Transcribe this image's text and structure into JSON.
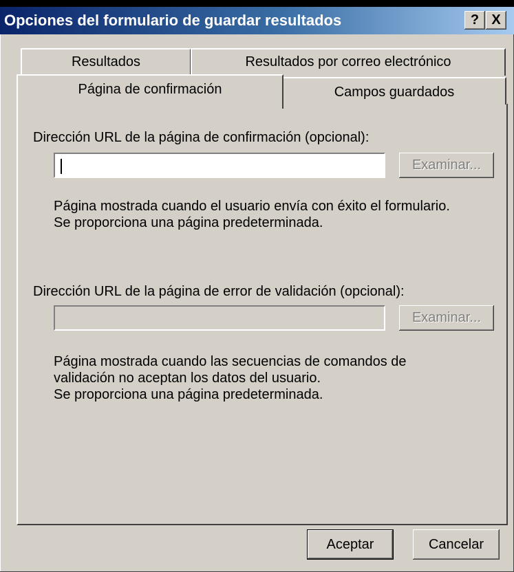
{
  "window": {
    "title": "Opciones del formulario de guardar resultados",
    "help_label": "?",
    "close_label": "X"
  },
  "tabs": {
    "resultados": "Resultados",
    "correo": "Resultados por correo electrónico",
    "confirmacion": "Página de confirmación",
    "campos": "Campos guardados",
    "active": "Página de confirmación"
  },
  "confirmation": {
    "label": "Dirección URL de la página de confirmación (opcional):",
    "value": "",
    "browse_label": "Examinar...",
    "description": [
      "Página mostrada cuando el usuario envía con éxito el formulario.",
      "Se proporciona una página predeterminada."
    ]
  },
  "validation": {
    "label": "Dirección URL de la página de error de validación (opcional):",
    "value": "",
    "browse_label": "Examinar...",
    "description": [
      "Página mostrada cuando las secuencias de comandos de",
      "validación no aceptan los datos del usuario.",
      "Se proporciona una página predeterminada."
    ]
  },
  "buttons": {
    "ok": "Aceptar",
    "cancel": "Cancelar"
  },
  "colors": {
    "dialog_bg": "#d4d0c8",
    "title_start": "#0a246a",
    "title_end": "#a6caf0"
  }
}
